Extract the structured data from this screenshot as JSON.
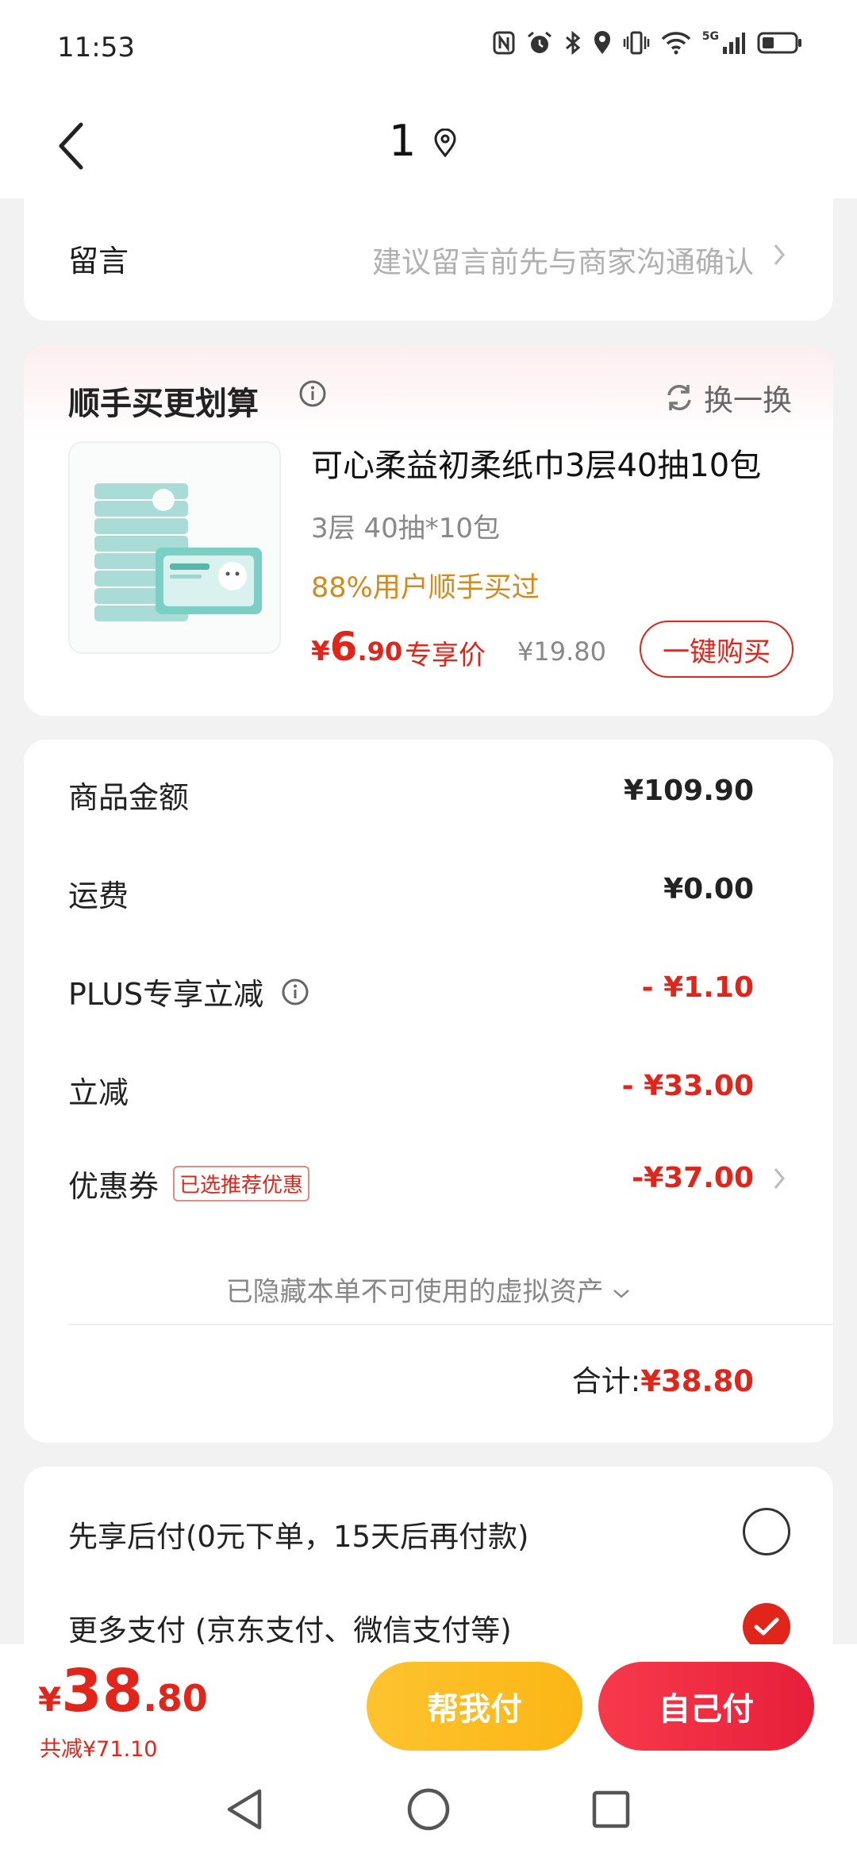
{
  "status_bar": {
    "time": "11:53",
    "network": "5G"
  },
  "nav": {
    "title": "1",
    "back_icon": "back-chevron-icon",
    "location_icon": "location-pin-icon"
  },
  "message": {
    "label": "留言",
    "hint": "建议留言前先与商家沟通确认"
  },
  "recommend": {
    "title": "顺手买更划算",
    "swap_label": "换一换",
    "product": {
      "name": "可心柔益初柔纸巾3层40抽10包",
      "spec": "3层 40抽*10包",
      "promo": "88%用户顺手买过",
      "price_currency": "¥",
      "price_int": "6",
      "price_dec": ".90",
      "exclusive_label": "专享价",
      "original_price": "¥19.80",
      "buy_label": "一键购买"
    }
  },
  "summary": {
    "rows": [
      {
        "label": "商品金额",
        "value": "¥109.90"
      },
      {
        "label": "运费",
        "value": "¥0.00"
      },
      {
        "label": "PLUS专享立减",
        "value": "- ¥1.10"
      },
      {
        "label": "立减",
        "value": "- ¥33.00"
      },
      {
        "label": "优惠券",
        "tag": "已选推荐优惠",
        "value": "-¥37.00"
      }
    ],
    "hidden_assets": "已隐藏本单不可使用的虚拟资产",
    "total_label": "合计:",
    "total_value": "¥38.80"
  },
  "payment": {
    "options": [
      {
        "label": "先享后付(0元下单，15天后再付款)",
        "selected": false
      },
      {
        "label": "更多支付 (京东支付、微信支付等)",
        "selected": true
      }
    ]
  },
  "bottom": {
    "price_currency": "¥",
    "price_int": "38",
    "price_dec": ".80",
    "saved": "共减¥71.10",
    "help_pay": "帮我付",
    "self_pay": "自己付"
  },
  "colors": {
    "accent_red": "#e1251b",
    "help_yellow": "#fbb615",
    "promo_orange": "#d58a1c"
  }
}
